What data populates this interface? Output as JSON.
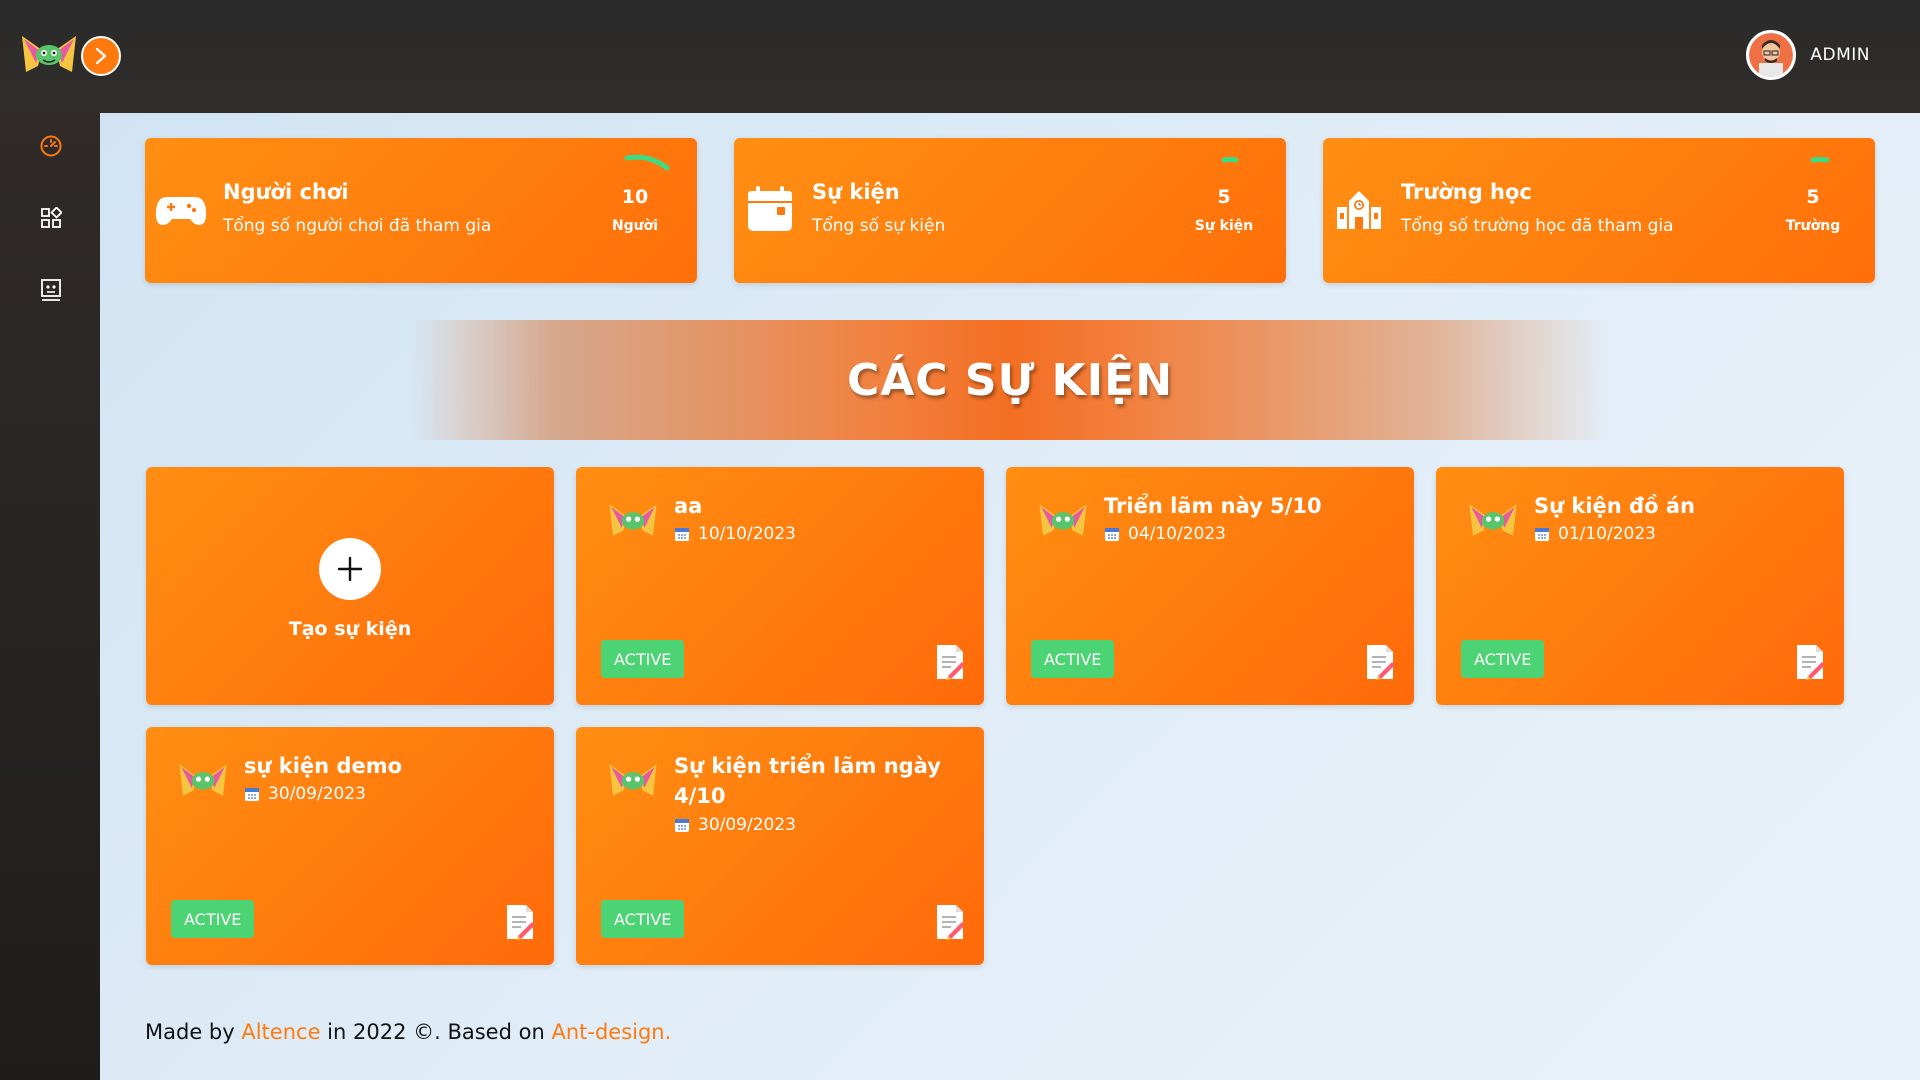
{
  "header": {
    "username": "ADMIN"
  },
  "sidebar": {
    "items": [
      {
        "icon": "dashboard-icon"
      },
      {
        "icon": "apps-icon"
      },
      {
        "icon": "robot-icon"
      }
    ]
  },
  "stats": [
    {
      "title": "Người chơi",
      "subtitle": "Tổng số người chơi đã tham gia",
      "value": "10",
      "unit": "Người",
      "icon": "gamepad-icon"
    },
    {
      "title": "Sự kiện",
      "subtitle": "Tổng số sự kiện",
      "value": "5",
      "unit": "Sự kiện",
      "icon": "calendar-icon"
    },
    {
      "title": "Trường học",
      "subtitle": "Tổng số trường học đã tham gia",
      "value": "5",
      "unit": "Trường",
      "icon": "school-icon"
    }
  ],
  "banner": {
    "title": "CÁC SỰ KIỆN"
  },
  "create_card": {
    "label": "Tạo sự kiện"
  },
  "events": [
    {
      "title": "aa",
      "date": "10/10/2023",
      "status": "ACTIVE"
    },
    {
      "title": "Triển lãm này 5/10",
      "date": "04/10/2023",
      "status": "ACTIVE"
    },
    {
      "title": "Sự kiện đồ án",
      "date": "01/10/2023",
      "status": "ACTIVE"
    },
    {
      "title": "sự kiện demo",
      "date": "30/09/2023",
      "status": "ACTIVE"
    },
    {
      "title": "Sự kiện triển lãm ngày 4/10",
      "date": "30/09/2023",
      "status": "ACTIVE"
    }
  ],
  "footer": {
    "prefix": "Made by ",
    "author": "Altence",
    "middle": " in 2022 ©. Based on ",
    "framework": "Ant-design."
  },
  "colors": {
    "accent": "#ff7a0e",
    "active_badge": "#4cd474",
    "arc": "#3ddc84"
  }
}
